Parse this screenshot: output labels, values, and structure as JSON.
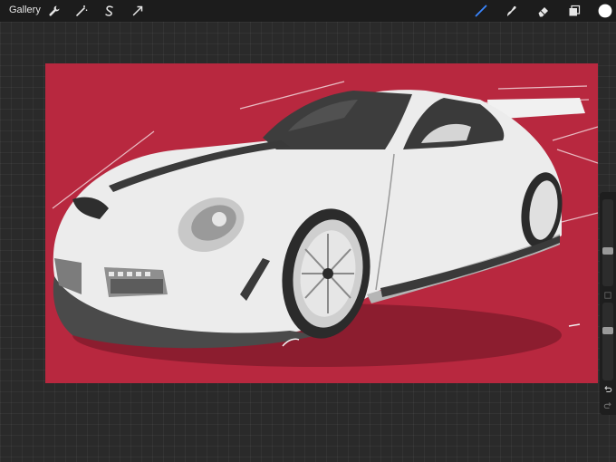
{
  "app": {
    "gallery_label": "Gallery"
  },
  "toolbar": {
    "left_tools": [
      "wrench-icon",
      "magic-wand-icon",
      "selection-icon",
      "transform-arrow-icon"
    ],
    "right_tools": [
      "brush-icon",
      "smudge-icon",
      "eraser-icon",
      "layers-icon",
      "color-swatch"
    ],
    "active_tool": "brush",
    "active_color": "#3a86ff",
    "current_color": "#ffffff"
  },
  "sidebar": {
    "brush_size_level": 0.35,
    "opacity_level": 0.55,
    "controls": [
      "brush-size-slider",
      "modify-button",
      "opacity-slider",
      "undo-button",
      "redo-button"
    ]
  },
  "canvas": {
    "background_color": "#b8283f",
    "subject": "sports-car-illustration"
  }
}
